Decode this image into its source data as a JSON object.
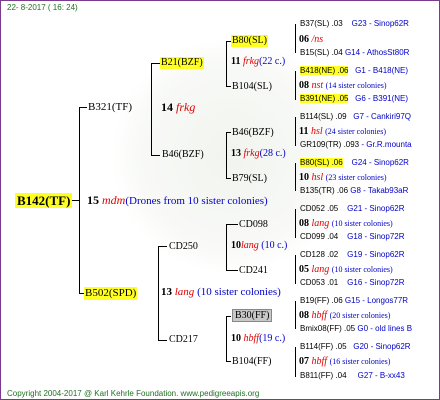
{
  "header": {
    "date": "22-  8-2017 ( 16: 24)"
  },
  "footer": {
    "copyright": "Copyright 2004-2017 @ Karl Kehrle Foundation.   www.pedigreeapis.org"
  },
  "root": {
    "name": "B142(TF)",
    "num": "15",
    "mark": "mdm",
    "note": "(Drones from 10 sister colonies)"
  },
  "sire": {
    "name": "B321(TF)",
    "num": "14",
    "mark": "frkg",
    "a": {
      "name": "B21(BZF)",
      "num": "11",
      "mark": "frkg",
      "note": "(22 c.)",
      "a": {
        "name": "B80(SL)",
        "num": "06",
        "mark": "/ns",
        "l1": "B37(SL) .03",
        "l1b": "G23 - Sinop62R",
        "l2": "B15(SL) .04",
        "l2b": "G14 - AthosSt80R"
      },
      "b": {
        "name": "B104(SL)",
        "num": "08",
        "mark": "nst",
        "note": "(14 sister colonies)",
        "l1": "B418(NE) .06",
        "l1b": "G1 - B418(NE)",
        "l2": "B391(NE) .05",
        "l2b": "G6 - B391(NE)"
      }
    },
    "b": {
      "name": "B46(BZF)",
      "num": "13",
      "mark": "frkg",
      "note": "(28 c.)",
      "a": {
        "name": "B46(BZF)",
        "num": "11",
        "mark": "hsl",
        "note": "(24 sister colonies)",
        "l1": "B114(SL) .09",
        "l1b": "G7 - Cankiri97Q",
        "l2": "GR109(TR) .093",
        "l2b": "- Gr.R.mounta"
      },
      "b": {
        "name": "B79(SL)",
        "num": "10",
        "mark": "hsl",
        "note": "(23 sister colonies)",
        "l1": "B80(SL) .06",
        "l1b": "G24 - Sinop62R",
        "l2": "B135(TR) .06",
        "l2b": "G8 - Takab93aR"
      }
    }
  },
  "dam": {
    "name": "B502(SPD)",
    "num": "13",
    "mark": "lang",
    "note": "(10 sister colonies)",
    "a": {
      "name": "CD250",
      "num": "10",
      "mark": "lang",
      "note": "(10 c.)",
      "a": {
        "name": "CD098",
        "num": "08",
        "mark": "lang",
        "note": "(10 sister colonies)",
        "l1": "CD052 .05",
        "l1b": "G21 - Sinop62R",
        "l2": "CD099 .04",
        "l2b": "G18 - Sinop72R"
      },
      "b": {
        "name": "CD241",
        "num": "05",
        "mark": "lang",
        "note": "(10 sister colonies)",
        "l1": "CD128 .02",
        "l1b": "G19 - Sinop62R",
        "l2": "CD053 .01",
        "l2b": "G16 - Sinop72R"
      }
    },
    "b": {
      "name": "CD217",
      "num": "10",
      "mark": "hbff",
      "note": "(19 c.)",
      "a": {
        "name": "B30(FF)",
        "num": "08",
        "mark": "hbff",
        "note": "(20 sister colonies)",
        "l1": "B19(FF) .06",
        "l1b": "G15 - Longos77R",
        "l2": "Bmix08(FF) .05",
        "l2b": "G0 - old lines B"
      },
      "b": {
        "name": "B104(FF)",
        "num": "07",
        "mark": "hbff",
        "note": "(16 sister colonies)",
        "l1": "B114(FF) .05",
        "l1b": "G20 - Sinop62R",
        "l2": "B811(FF) .04",
        "l2b": "G27 - B-xx43"
      }
    }
  }
}
